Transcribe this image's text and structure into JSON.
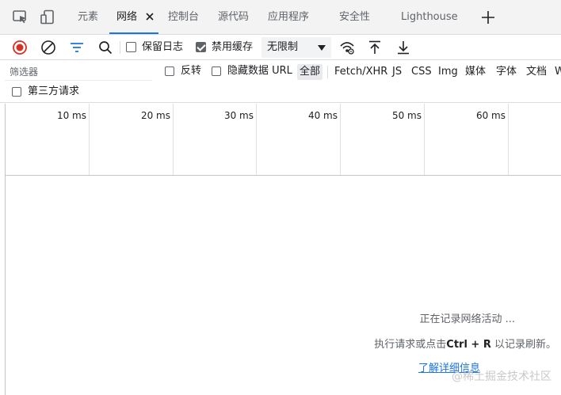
{
  "tabs": [
    {
      "label": "元素"
    },
    {
      "label": "网络"
    },
    {
      "label": "控制台"
    },
    {
      "label": "源代码"
    },
    {
      "label": "应用程序"
    },
    {
      "label": "安全性"
    },
    {
      "label": "Lighthouse"
    }
  ],
  "toolbar": {
    "preserve_log_label": "保留日志",
    "preserve_log_checked": false,
    "disable_cache_label": "禁用缓存",
    "disable_cache_checked": true,
    "throttle_value": "无限制"
  },
  "filter": {
    "placeholder": "筛选器",
    "invert_label": "反转",
    "hide_data_urls_label": "隐藏数据 URL",
    "third_party_label": "第三方请求",
    "types": [
      "全部",
      "Fetch/XHR",
      "JS",
      "CSS",
      "Img",
      "媒体",
      "字体",
      "文档",
      "W"
    ]
  },
  "timeline": {
    "ticks": [
      "10 ms",
      "20 ms",
      "30 ms",
      "40 ms",
      "50 ms",
      "60 ms"
    ]
  },
  "empty_state": {
    "recording_text": "正在记录网络活动 ...",
    "hint_prefix": "执行请求或点击",
    "hint_shortcut": "Ctrl + R",
    "hint_suffix": " 以记录刷新。",
    "learn_more_link": "了解详细信息"
  },
  "watermark": "@稀土掘金技术社区",
  "colors": {
    "accent": "#1a73e8",
    "record_red": "#d93025",
    "filter_blue": "#1a73e8"
  }
}
